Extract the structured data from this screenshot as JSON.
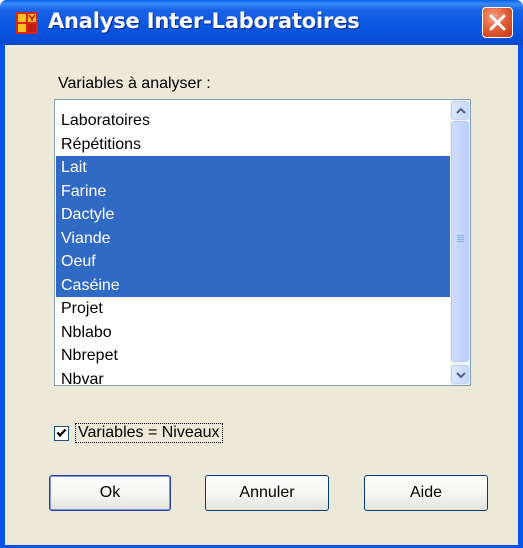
{
  "window": {
    "title": "Analyse Inter-Laboratoires",
    "icons": {
      "app": "app-logo-icon",
      "close": "close-icon"
    },
    "colors": {
      "titlebar": "#0a58e2",
      "client": "#ece9d8",
      "selection": "#316ac5",
      "close": "#d0431c"
    }
  },
  "variables": {
    "label": "Variables à analyser :",
    "items": [
      {
        "label": "Laboratoires",
        "selected": false
      },
      {
        "label": "Répétitions",
        "selected": false
      },
      {
        "label": "Lait",
        "selected": true
      },
      {
        "label": "Farine",
        "selected": true
      },
      {
        "label": "Dactyle",
        "selected": true
      },
      {
        "label": "Viande",
        "selected": true
      },
      {
        "label": "Oeuf",
        "selected": true
      },
      {
        "label": "Caséine",
        "selected": true
      },
      {
        "label": "Projet",
        "selected": false
      },
      {
        "label": "Nblabo",
        "selected": false
      },
      {
        "label": "Nbrepet",
        "selected": false
      },
      {
        "label": "Nbvar",
        "selected": false
      }
    ],
    "scroll_icons": {
      "up": "scroll-up-arrow-icon",
      "down": "scroll-down-arrow-icon"
    }
  },
  "option": {
    "label": "Variables = Niveaux",
    "checked": true
  },
  "buttons": {
    "ok": "Ok",
    "cancel": "Annuler",
    "help": "Aide"
  }
}
